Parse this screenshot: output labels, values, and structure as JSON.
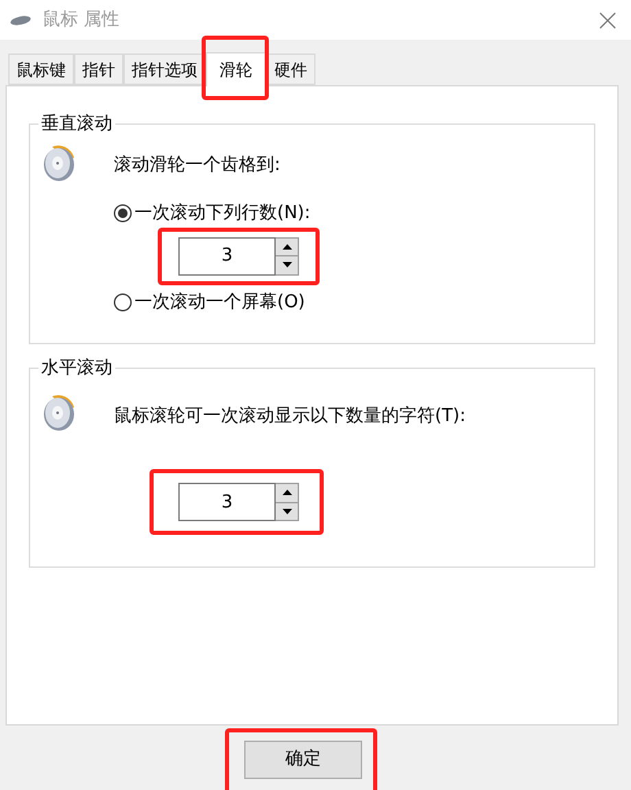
{
  "window": {
    "title": "鼠标 属性"
  },
  "tabs": [
    {
      "label": "鼠标键",
      "selected": false
    },
    {
      "label": "指针",
      "selected": false
    },
    {
      "label": "指针选项",
      "selected": false
    },
    {
      "label": "滑轮",
      "selected": true
    },
    {
      "label": "硬件",
      "selected": false
    }
  ],
  "vertical_scrolling": {
    "legend": "垂直滚动",
    "prompt": "滚动滑轮一个齿格到:",
    "options": [
      {
        "label": "一次滚动下列行数(N):",
        "selected": true
      },
      {
        "label": "一次滚动一个屏幕(O)",
        "selected": false
      }
    ],
    "spinner": {
      "value": "3"
    }
  },
  "horizontal_scrolling": {
    "legend": "水平滚动",
    "prompt": "鼠标滚轮可一次滚动显示以下数量的字符(T):",
    "spinner": {
      "value": "3"
    }
  },
  "buttons": [
    {
      "label": "确定"
    }
  ]
}
